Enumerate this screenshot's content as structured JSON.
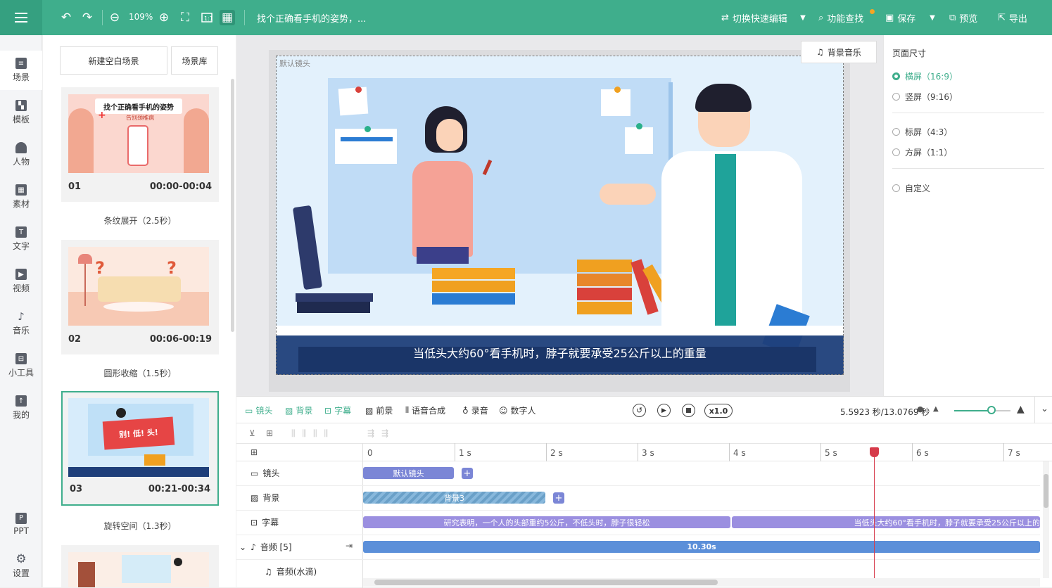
{
  "topbar": {
    "undo_icon": "undo-icon",
    "redo_icon": "redo-icon",
    "zoom": "109%",
    "project_title": "找个正确看手机的姿势，...",
    "quick_edit": "切换快速编辑",
    "feature_search": "功能查找",
    "save": "保存",
    "preview": "预览",
    "export": "导出"
  },
  "nav": [
    {
      "label": "场景",
      "icon": "scene-icon"
    },
    {
      "label": "模板",
      "icon": "template-icon"
    },
    {
      "label": "人物",
      "icon": "person-icon"
    },
    {
      "label": "素材",
      "icon": "material-icon"
    },
    {
      "label": "文字",
      "icon": "text-icon"
    },
    {
      "label": "视频",
      "icon": "video-icon"
    },
    {
      "label": "音乐",
      "icon": "music-icon"
    },
    {
      "label": "小工具",
      "icon": "tools-icon"
    },
    {
      "label": "我的",
      "icon": "mine-icon"
    },
    {
      "label": "PPT",
      "icon": "ppt-icon"
    },
    {
      "label": "设置",
      "icon": "settings-icon"
    }
  ],
  "scenes": {
    "new_blank": "新建空白场景",
    "library": "场景库",
    "items": [
      {
        "num": "01",
        "time": "00:00-00:04",
        "transition": "条纹展开（2.5秒）",
        "thumb_title": "找个正确看手机的姿势",
        "thumb_sub": "告别颈椎病"
      },
      {
        "num": "02",
        "time": "00:06-00:19",
        "transition": "圆形收缩（1.5秒）"
      },
      {
        "num": "03",
        "time": "00:21-00:34",
        "transition": "旋转空间（1.3秒）",
        "thumb_banner": "别! 低! 头!"
      }
    ]
  },
  "canvas": {
    "camera_label": "默认镜头",
    "bg_music": "背景音乐",
    "subtitle": "当低头大约60°看手机时，脖子就要承受25公斤以上的重量"
  },
  "page_size": {
    "title": "页面尺寸",
    "options": [
      "横屏（16:9）",
      "竖屏（9:16）",
      "标屏（4:3）",
      "方屏（1:1）",
      "自定义"
    ],
    "selected": 0
  },
  "timeline": {
    "tools": [
      "镜头",
      "背景",
      "字幕",
      "前景",
      "语音合成",
      "录音",
      "数字人"
    ],
    "speed": "x1.0",
    "time_readout": "5.5923 秒/13.0769 秒",
    "ruler": [
      "0",
      "1 s",
      "2 s",
      "3 s",
      "4 s",
      "5 s",
      "6 s",
      "7 s"
    ],
    "tracks": {
      "camera": "镜头",
      "background": "背景",
      "subtitle": "字幕",
      "audio": "音频 [5]",
      "audio_sub": "音频(水滴)"
    },
    "clips": {
      "camera": "默认镜头",
      "background": "背景3",
      "subtitle_1": "研究表明，一个人的头部重约5公斤，不低头时，脖子很轻松",
      "subtitle_2": "当低头大约60°看手机时，脖子就要承受25公斤以上的",
      "audio": "10.30s"
    },
    "playhead_seconds": 5.5923,
    "total_seconds": 13.0769
  },
  "colors": {
    "brand": "#3fae8c",
    "clip_camera": "#7b86d6",
    "clip_subtitle": "#9b8fe0",
    "clip_audio": "#5b8fd9",
    "playhead": "#d63a4a"
  }
}
